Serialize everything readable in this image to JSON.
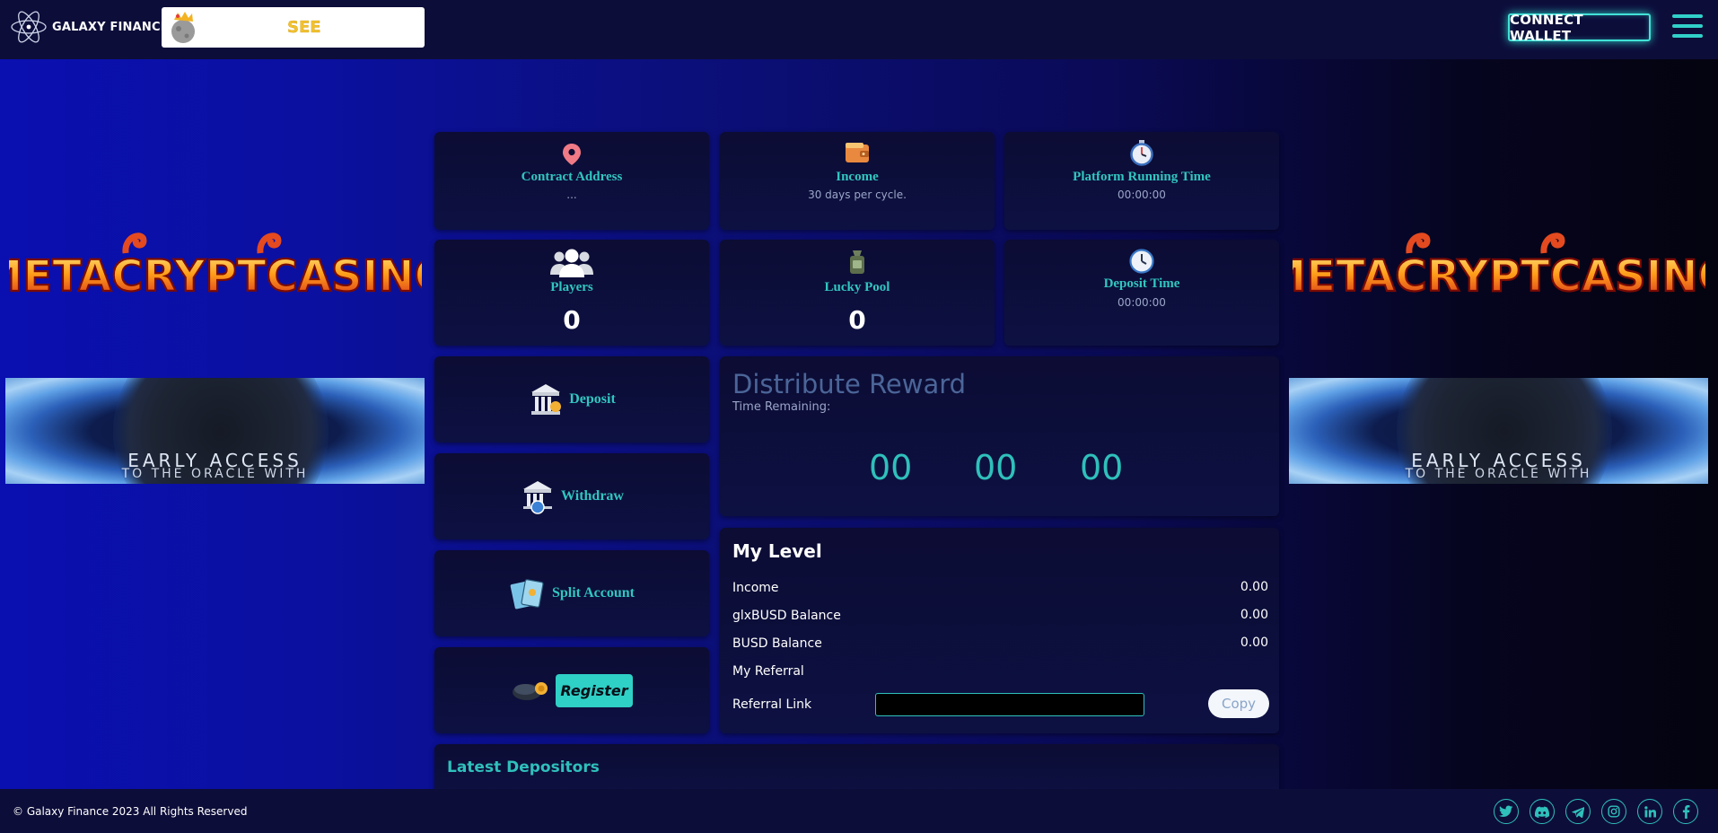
{
  "header": {
    "brand_name": "GALAXY FINANCE",
    "ticker_text": "SEE",
    "connect_wallet_label": "CONNECT WALLET"
  },
  "side_banners": {
    "casino_text": "METACRYPTCASINO",
    "oracle_line1": "EARLY ACCESS",
    "oracle_line2": "TO THE ORACLE WITH"
  },
  "stats": {
    "contract_address": {
      "title": "Contract Address",
      "value": "..."
    },
    "income": {
      "title": "Income",
      "sub": "30 days per cycle."
    },
    "platform_running_time": {
      "title": "Platform Running Time",
      "value": "00:00:00"
    },
    "players": {
      "title": "Players",
      "value": "0"
    },
    "lucky_pool": {
      "title": "Lucky Pool",
      "value": "0"
    },
    "deposit_time": {
      "title": "Deposit Time",
      "value": "00:00:00"
    }
  },
  "actions": {
    "deposit_label": "Deposit",
    "withdraw_label": "Withdraw",
    "split_account_label": "Split Account",
    "register_label": "Register"
  },
  "distribute": {
    "title": "Distribute Reward",
    "subtitle": "Time Remaining:",
    "hours": "00",
    "minutes": "00",
    "seconds": "00"
  },
  "my_level": {
    "title": "My Level",
    "rows": [
      {
        "label": "Income",
        "value": "0.00"
      },
      {
        "label": "glxBUSD Balance",
        "value": "0.00"
      },
      {
        "label": "BUSD Balance",
        "value": "0.00"
      },
      {
        "label": "My Referral",
        "value": ""
      }
    ],
    "referral_link_label": "Referral Link",
    "copy_label": "Copy"
  },
  "latest_depositors": {
    "title": "Latest Depositors"
  },
  "footer": {
    "copyright": "© Galaxy Finance 2023 All Rights Reserved",
    "social_icons": [
      "twitter-icon",
      "discord-icon",
      "telegram-icon",
      "instagram-icon",
      "linkedin-icon",
      "facebook-icon"
    ]
  },
  "colors": {
    "accent": "#2fc0bb",
    "header_bg": "#0d0d3a",
    "card_bg": "#0c0c34",
    "ticker_text": "#f2c12e"
  }
}
